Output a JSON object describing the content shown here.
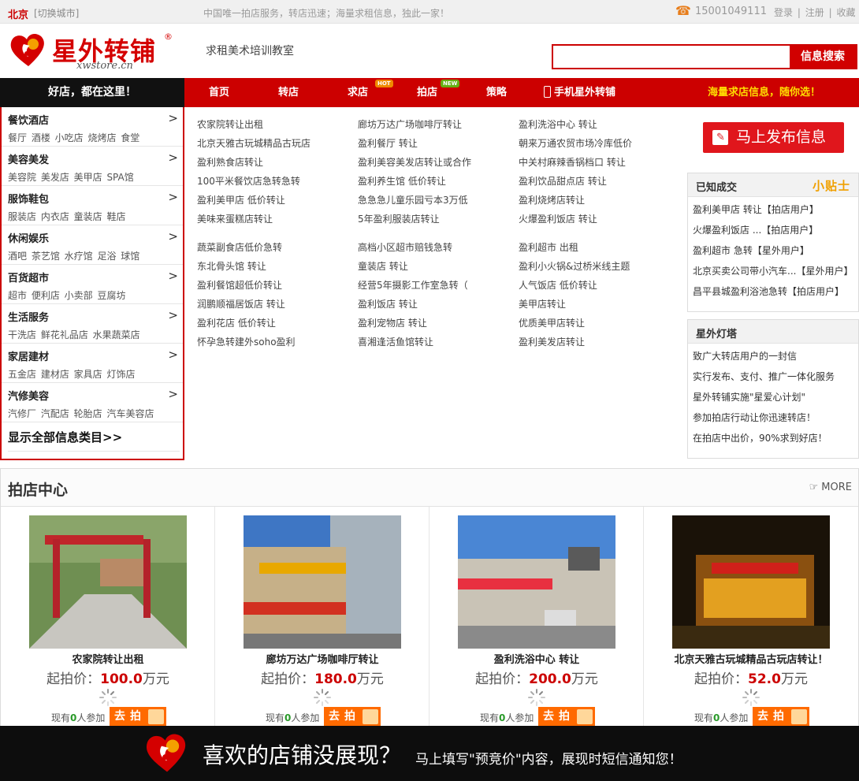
{
  "topbar": {
    "city": "北京",
    "switch_city": "[切换城市]",
    "slogan": "中国唯一拍店服务，转店迅速；海量求租信息，独此一家！",
    "phone_icon": "phone-icon",
    "phone": "15001049111",
    "login": "登录",
    "register": "注册",
    "favorite": "收藏",
    "sep": "|"
  },
  "header": {
    "logo_name": "星外转铺",
    "logo_reg": "®",
    "logo_url": "xwstore.cn",
    "wanted_text": "求租美术培训教室",
    "search_value": "",
    "search_button": "信息搜索"
  },
  "nav": {
    "good_text": "好店，都在这里！",
    "items": [
      "首页",
      "转店",
      "求店",
      "拍店",
      "策略"
    ],
    "hot_badge": "HOT",
    "new_badge": "NEW",
    "mobile": "手机星外转铺",
    "right_text": "海量求店信息，随你选！"
  },
  "categories": [
    {
      "title": "餐饮酒店",
      "subs": "餐厅 酒楼 小吃店 烧烤店 食堂"
    },
    {
      "title": "美容美发",
      "subs": "美容院 美发店 美甲店 SPA馆"
    },
    {
      "title": "服饰鞋包",
      "subs": "服装店 内衣店 童装店 鞋店"
    },
    {
      "title": "休闲娱乐",
      "subs": "酒吧 茶艺馆 水疗馆 足浴 球馆"
    },
    {
      "title": "百货超市",
      "subs": "超市 便利店 小卖部 豆腐坊"
    },
    {
      "title": "生活服务",
      "subs": "干洗店 鲜花礼品店 水果蔬菜店"
    },
    {
      "title": "家居建材",
      "subs": "五金店 建材店 家具店 灯饰店"
    },
    {
      "title": "汽修美容",
      "subs": "汽修厂 汽配店 轮胎店 汽车美容店"
    }
  ],
  "cat_arrow": ">",
  "show_all": "显示全部信息类目>>",
  "listings": {
    "col1": [
      "农家院转让出租",
      "北京天雅古玩城精品古玩店",
      "盈利熟食店转让",
      "100平米餐饮店急转急转",
      "盈利美甲店 低价转让",
      "美味来蛋糕店转让",
      "",
      "蔬菜副食店低价急转",
      "东北骨头馆 转让",
      "盈利餐馆超低价转让",
      "润鹏顺福居饭店 转让",
      "盈利花店 低价转让",
      "怀孕急转建外soho盈利"
    ],
    "col2": [
      "廊坊万达广场咖啡厅转让",
      "盈利餐厅 转让",
      "盈利美容美发店转让或合作",
      "盈利养生馆 低价转让",
      "急急急儿童乐园亏本3万低",
      "5年盈利服装店转让",
      "",
      "高档小区超市赔钱急转",
      "童装店 转让",
      "经营5年摄影工作室急转（",
      "盈利饭店 转让",
      "盈利宠物店 转让",
      "喜湘逢活鱼馆转让"
    ],
    "col3": [
      "盈利洗浴中心 转让",
      "朝来万通农贸市场冷库低价",
      "中关村麻辣香锅档口 转让",
      "盈利饮品甜点店 转让",
      "盈利烧烤店转让",
      "火爆盈利饭店 转让",
      "",
      "盈利超市 出租",
      "盈利小火锅&过桥米线主题",
      "人气饭店 低价转让",
      "美甲店转让",
      "优质美甲店转让",
      "盈利美发店转让"
    ]
  },
  "publish": {
    "icon": "edit-icon",
    "label": "马上发布信息"
  },
  "deals": {
    "title": "已知成交",
    "tip": "小贴士",
    "rows": [
      "盈利美甲店 转让【拍店用户】",
      "火爆盈利饭店 ...【拍店用户】",
      "盈利超市 急转【星外用户】",
      "北京买卖公司带小汽车...【星外用户】",
      "昌平县城盈利浴池急转【拍店用户】"
    ]
  },
  "lamp": {
    "title": "星外灯塔",
    "rows": [
      "致广大转店用户的一封信",
      "实行发布、支付、推广一体化服务",
      "星外转铺实施\"星爱心计划\"",
      "参加拍店行动让你迅速转店！",
      "在拍店中出价，90%求到好店！"
    ]
  },
  "auction": {
    "title": "拍店中心",
    "more": "MORE",
    "price_prefix": "起拍价：",
    "price_unit": "万元",
    "people_prefix": "现有",
    "people_suffix": "人参加",
    "go_label": "去拍",
    "cards": [
      {
        "name": "农家院转让出租",
        "price": "100.0",
        "count": "0"
      },
      {
        "name": "廊坊万达广场咖啡厅转让",
        "price": "180.0",
        "count": "0"
      },
      {
        "name": "盈利洗浴中心 转让",
        "price": "200.0",
        "count": "0"
      },
      {
        "name": "北京天雅古玩城精品古玩店转让！",
        "price": "52.0",
        "count": "0"
      }
    ]
  },
  "banner": {
    "big": "喜欢的店铺没展现？",
    "small": "马上填写\"预竞价\"内容，展现时短信通知您！"
  },
  "colors": {
    "brand_red": "#cc0000",
    "accent_orange": "#ff6a00",
    "nav_yellow": "#ffde00"
  }
}
